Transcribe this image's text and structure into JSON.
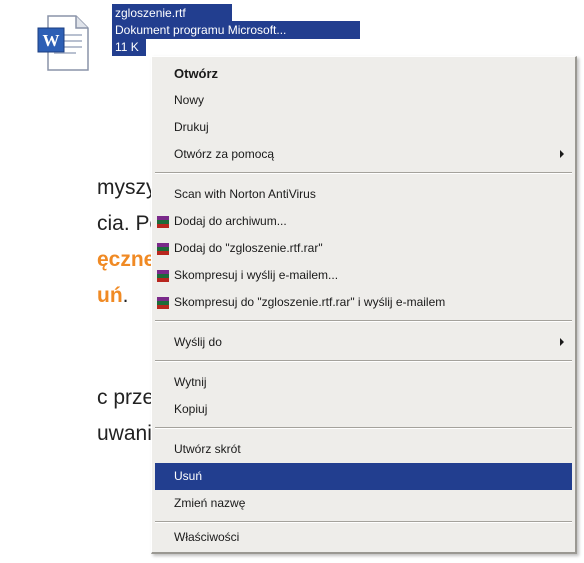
{
  "file": {
    "name": "zgloszenie.rtf",
    "type": "Dokument programu Microsoft...",
    "size": "11 K"
  },
  "document": {
    "lines": [
      "myszy",
      "cia. Po",
      "ęczne-",
      "uń",
      "przeprze-",
      "uwania"
    ],
    "line1": "myszy",
    "line2": "cia. Po",
    "line3": "ęczne-",
    "line4": "uń",
    "line4_suffix": ".",
    "line5": "c prze-",
    "line6": "uwania"
  },
  "menu": {
    "open": "Otwórz",
    "new": "Nowy",
    "print": "Drukuj",
    "open_with": "Otwórz za pomocą",
    "norton_scan": "Scan with Norton AntiVirus",
    "add_to_archive": "Dodaj do archiwum...",
    "add_to_rar": "Dodaj do \"zgloszenie.rtf.rar\"",
    "compress_email": "Skompresuj i wyślij e-mailem...",
    "compress_rar_email": "Skompresuj do \"zgloszenie.rtf.rar\" i wyślij e-mailem",
    "send_to": "Wyślij do",
    "cut": "Wytnij",
    "copy": "Kopiuj",
    "create_shortcut": "Utwórz skrót",
    "delete": "Usuń",
    "rename": "Zmień nazwę",
    "properties": "Właściwości"
  },
  "colors": {
    "selection": "#223e8f",
    "highlight_text": "#f08a24",
    "menu_bg": "#eeedea"
  },
  "icons": {
    "file": "word-document-icon",
    "archive": "winrar-icon",
    "submenu": "submenu-arrow-icon"
  }
}
